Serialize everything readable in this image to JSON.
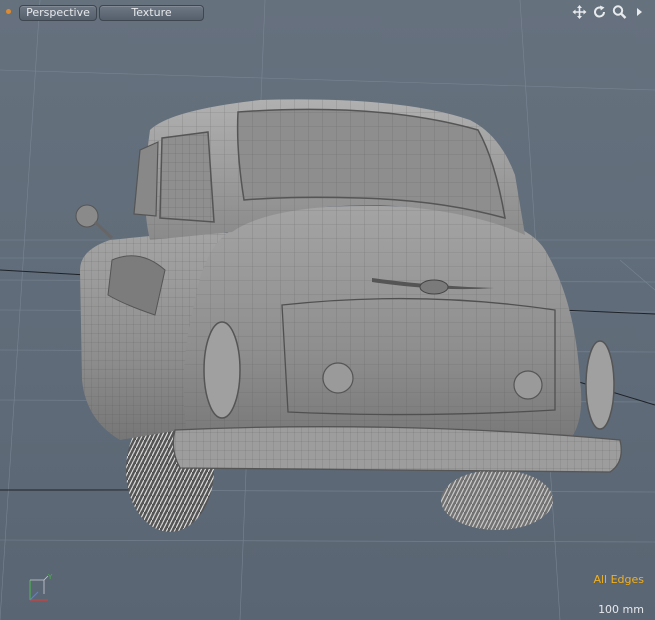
{
  "viewport": {
    "view_label": "Perspective",
    "shading_label": "Texture",
    "status_text": "All Edges",
    "grid_scale": "100 mm"
  },
  "nav_icons": [
    "move-view-icon",
    "rotate-view-icon",
    "zoom-view-icon",
    "viewport-menu-arrow-icon"
  ],
  "axis_gizmo": {
    "x_label": "",
    "y_label": "Y",
    "z_label": ""
  },
  "colors": {
    "background": "#5e6b79",
    "model": "#9a9a9a",
    "status": "#f0b020",
    "grid": "#7e8a97"
  }
}
